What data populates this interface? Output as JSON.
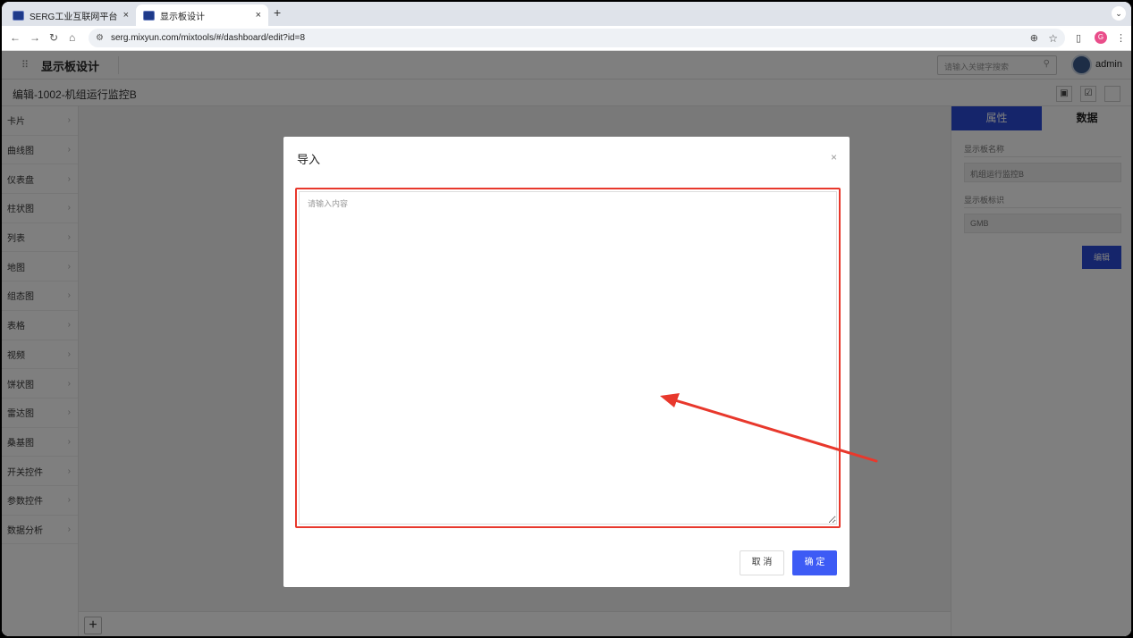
{
  "browser": {
    "tabs": [
      {
        "title": "SERG工业互联网平台",
        "close": "×"
      },
      {
        "title": "显示板设计",
        "close": "×"
      }
    ],
    "new_tab": "+",
    "tab_menu": "⌄",
    "url": "serg.mixyun.com/mixtools/#/dashboard/edit?id=8",
    "profile_initial": "G"
  },
  "header": {
    "title": "显示板设计",
    "search_placeholder": "请输入关键字搜索",
    "user": "admin"
  },
  "subheader": {
    "title": "编辑-1002-机组运行监控B"
  },
  "sidebar": {
    "items": [
      "卡片",
      "曲线图",
      "仪表盘",
      "柱状图",
      "列表",
      "地图",
      "组态图",
      "表格",
      "视频",
      "饼状图",
      "雷达图",
      "桑基图",
      "开关控件",
      "参数控件",
      "数据分析"
    ]
  },
  "right_panel": {
    "tabs": [
      "属性",
      "数据"
    ],
    "name_label": "显示板名称",
    "name_value": "机组运行监控B",
    "id_label": "显示板标识",
    "id_value": "GMB",
    "edit_button": "编辑"
  },
  "canvas": {
    "add_label": "+"
  },
  "modal": {
    "title": "导入",
    "close": "×",
    "textarea_placeholder": "请输入内容",
    "cancel": "取 消",
    "confirm": "确 定"
  },
  "annotation": {
    "color": "#e8382c"
  }
}
